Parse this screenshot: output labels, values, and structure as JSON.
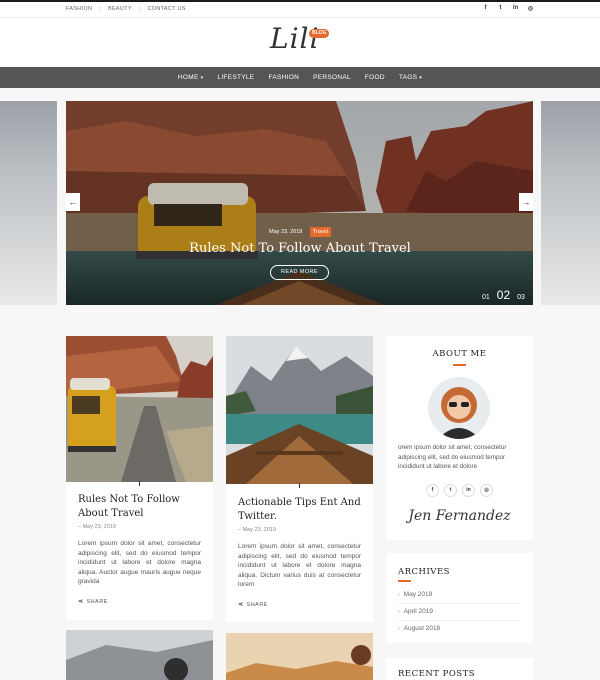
{
  "topbar": {
    "links": [
      "FASHION",
      "BEAUTY",
      "CONTACT US"
    ],
    "social_icons": [
      "facebook-icon",
      "twitter-icon",
      "linkedin-icon",
      "instagram-icon"
    ]
  },
  "logo": {
    "text": "Lili",
    "badge": "BLOG"
  },
  "nav": {
    "items": [
      {
        "label": "HOME",
        "has_dropdown": true
      },
      {
        "label": "LIFESTYLE",
        "has_dropdown": false
      },
      {
        "label": "FASHION",
        "has_dropdown": false
      },
      {
        "label": "PERSONAL",
        "has_dropdown": false
      },
      {
        "label": "FOOD",
        "has_dropdown": false
      },
      {
        "label": "TAGS",
        "has_dropdown": true
      }
    ]
  },
  "slider": {
    "date": "May 23, 2019",
    "tag": "Travel",
    "title": "Rules Not To Follow About Travel",
    "button": "READ MORE",
    "prev_icon": "←",
    "next_icon": "→",
    "pages": [
      "01",
      "02",
      "03"
    ],
    "active_page": "02"
  },
  "posts": [
    {
      "title_line1": "Rules Not To Follow",
      "title_line2": "About Travel",
      "date": "May 23, 2019",
      "excerpt": "Lorem ipsum dolor sit amet, consectetur adipiscing elit, sed do eiusmod tempor incididunt ut labore et dolore magna aliqua. Auctor augue mauris augue neque gravida",
      "share": "SHARE"
    },
    {
      "title_line1": "Actionable Tips Ent And",
      "title_line2": "Twitter.",
      "date": "May 23, 2019",
      "excerpt": "Lorem ipsum dolor sit amet, consectetur adipiscing elit, sed do eiusmod tempor incididunt ut labore et dolore magna aliqua. Dictum varius duis at consectetur lorem",
      "share": "SHARE"
    }
  ],
  "about": {
    "title": "ABOUT ME",
    "text": "orem ipsum dolor sit amet, consectetur adipiscing elit, sed do eiusmod tempor incididunt ut labore et dolore",
    "signature": "Jen Fernandez"
  },
  "archives": {
    "title": "ARCHIVES",
    "items": [
      "May 2019",
      "April 2019",
      "August 2018"
    ]
  },
  "recent": {
    "title": "RECENT POSTS"
  },
  "colors": {
    "accent": "#e26b2d",
    "nav_bg": "#555555"
  }
}
